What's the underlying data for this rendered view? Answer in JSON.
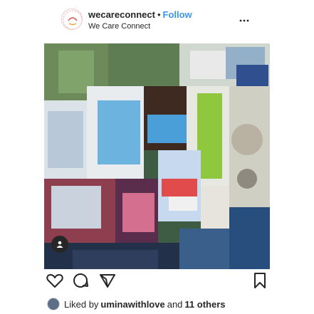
{
  "post": {
    "username": "wecareconnect",
    "separator": "•",
    "follow_label": "Follow",
    "subtitle": "We Care Connect",
    "more_icon": "more-horizontal-icon"
  },
  "photo": {
    "description_icon": "tagged-user-icon"
  },
  "actions": {
    "like_icon": "heart-icon",
    "comment_icon": "comment-icon",
    "share_icon": "share-icon",
    "save_icon": "bookmark-icon"
  },
  "likes": {
    "prefix": "Liked by",
    "user": "uminawithlove",
    "joiner": "and",
    "others": "11 others"
  },
  "colors": {
    "follow": "#3897f0",
    "text": "#262626"
  }
}
